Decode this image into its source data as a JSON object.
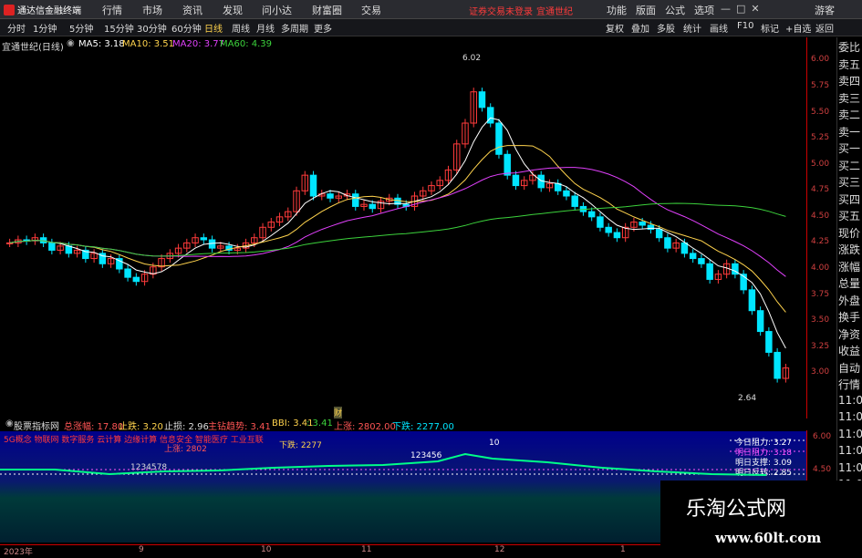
{
  "menubar": {
    "logo": "通达信金融终端",
    "items": [
      "行情",
      "市场",
      "资讯",
      "发现",
      "问小达",
      "财富圈",
      "交易"
    ],
    "warning": "证券交易未登录",
    "stock_link": "宜通世纪",
    "right_items": [
      "功能",
      "版面",
      "公式",
      "选项"
    ],
    "guest": "游客"
  },
  "toolbar": {
    "periods": [
      "分时",
      "1分钟",
      "5分钟",
      "15分钟",
      "30分钟",
      "60分钟",
      "日线",
      "周线",
      "月线",
      "多周期",
      "更多"
    ],
    "selected": "日线",
    "tools": [
      "复权",
      "叠加",
      "多股",
      "统计",
      "画线",
      "F10",
      "标记",
      "+自选",
      "返回"
    ]
  },
  "info": {
    "name": "宜通世纪(日线)",
    "ma5": "MA5: 3.18",
    "ma10": "MA10: 3.51",
    "ma20": "MA20: 3.77",
    "ma60": "MA60: 4.39"
  },
  "right_panel": [
    "委比",
    "卖五",
    "卖四",
    "卖三",
    "卖二",
    "卖一",
    "买一",
    "买二",
    "买三",
    "买四",
    "买五",
    "现价",
    "涨跌",
    "涨幅",
    "总量",
    "外盘",
    "换手",
    "净资",
    "收益",
    "自动",
    "行情",
    "11:0",
    "11:0",
    "11:0",
    "11:0",
    "11:0",
    "11:0",
    "11:0",
    "11:0",
    "11:0",
    "11:0"
  ],
  "price_axis": [
    "6.00",
    "5.75",
    "5.50",
    "5.25",
    "5.00",
    "4.75",
    "4.50",
    "4.25",
    "4.00",
    "3.75",
    "3.50",
    "3.25",
    "3.00"
  ],
  "annotations": {
    "high": "6.02",
    "low": "2.64",
    "cai": "财"
  },
  "sub": {
    "title": "股票指标网",
    "total": "总涨幅: 17.80",
    "stop": "止跌: 3.20",
    "stopv": "止损: 2.96",
    "trend": "主钻趋势: 3.41",
    "bbi": "BBI: 3.41",
    "bbi2": ": 3.41",
    "up": "上涨: 2802.00",
    "down": "下跌: 2277.00"
  },
  "sub_panel": {
    "tags": "5G概念 物联网 数字服务 云计算 边缘计算 信息安全 智能医疗 工业互联",
    "downlabel": "下跌: 2277",
    "uplabel": "上涨: 2802",
    "note10": "10",
    "seq": "123456",
    "seq2": "1234578",
    "right": [
      "今日阻力: 3.27",
      "明日阻力: 3.18",
      "明日支撑: 3.09",
      "明日反转: 2.85"
    ],
    "right_ticks": [
      "6.00",
      "4.50"
    ]
  },
  "dates": [
    "2023年",
    "9",
    "10",
    "11",
    "12",
    "1"
  ],
  "watermark": {
    "line1": "乐淘公式网",
    "line2": "www.60lt.com"
  },
  "colors": {
    "up": "#ff3b3b",
    "down": "#00e5ff",
    "ma5": "#ffffff",
    "ma10": "#ffd34d",
    "ma20": "#e040fb",
    "ma60": "#3cd23c"
  },
  "chart_data": {
    "type": "candlestick",
    "symbol": "宜通世纪",
    "period": "日线",
    "ylim": [
      2.6,
      6.1
    ],
    "closes": [
      4.25,
      4.28,
      4.27,
      4.3,
      4.25,
      4.18,
      4.22,
      4.15,
      4.18,
      4.1,
      4.15,
      4.05,
      4.1,
      4.0,
      3.92,
      3.88,
      3.95,
      4.02,
      4.1,
      4.15,
      4.2,
      4.25,
      4.3,
      4.28,
      4.2,
      4.22,
      4.18,
      4.2,
      4.25,
      4.3,
      4.4,
      4.45,
      4.5,
      4.55,
      4.75,
      4.9,
      4.7,
      4.72,
      4.68,
      4.7,
      4.72,
      4.6,
      4.62,
      4.58,
      4.65,
      4.68,
      4.62,
      4.6,
      4.7,
      4.75,
      4.8,
      4.85,
      4.95,
      5.2,
      5.4,
      5.7,
      5.55,
      5.4,
      5.1,
      4.9,
      4.8,
      4.85,
      4.9,
      4.78,
      4.82,
      4.75,
      4.7,
      4.6,
      4.55,
      4.5,
      4.4,
      4.35,
      4.3,
      4.4,
      4.45,
      4.42,
      4.38,
      4.3,
      4.2,
      4.25,
      4.15,
      4.1,
      4.05,
      3.9,
      3.95,
      4.05,
      3.95,
      3.8,
      3.6,
      3.4,
      3.2,
      2.95,
      3.05
    ]
  }
}
